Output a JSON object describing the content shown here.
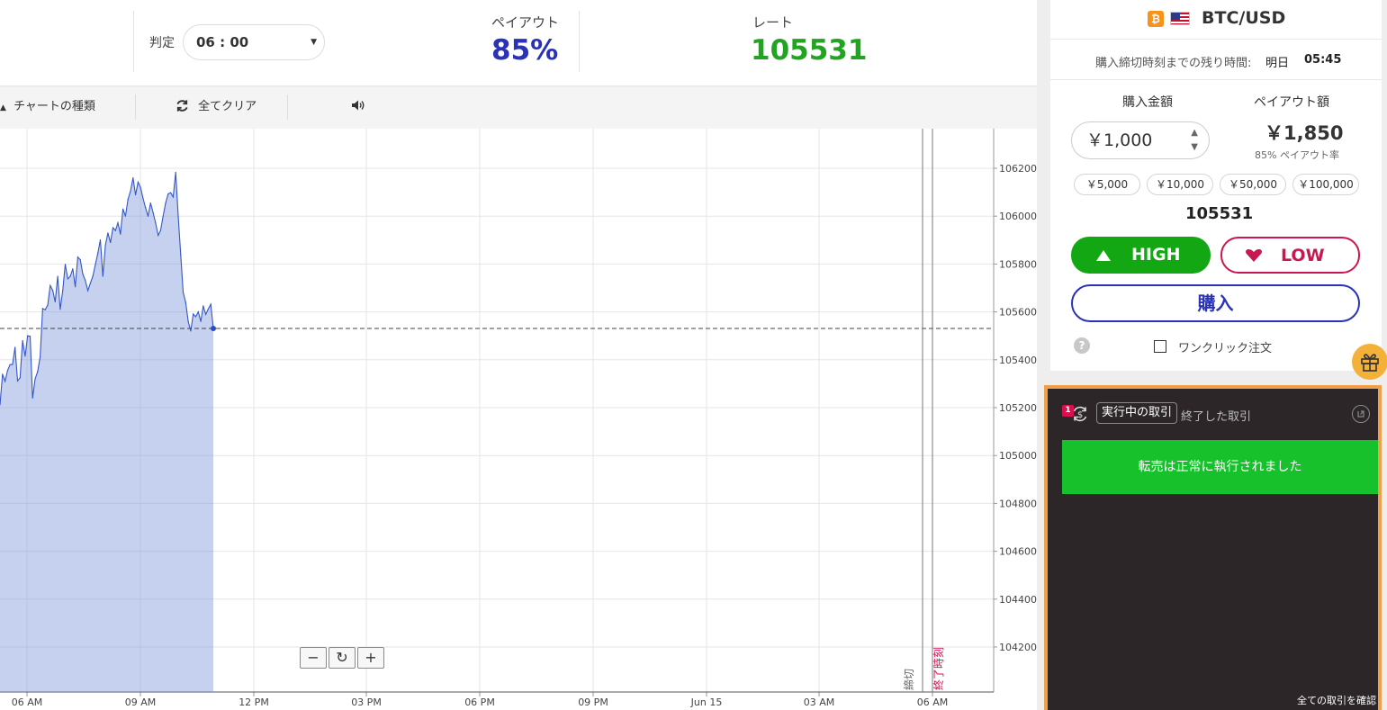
{
  "topbar": {
    "expiry_label": "判定",
    "expiry_value": "06 : 00",
    "payout_label": "ペイアウト",
    "payout_value": "85%",
    "rate_label": "レート",
    "rate_value": "105531"
  },
  "toolbar": {
    "chart_type_label": "チャートの種類",
    "clear_all_label": "全てクリア"
  },
  "chart_data": {
    "type": "area",
    "title": "",
    "xlabel": "",
    "ylabel": "",
    "x_tick_labels": [
      "06 AM",
      "09 AM",
      "12 PM",
      "03 PM",
      "06 PM",
      "09 PM",
      "Jun 15",
      "03 AM",
      "06 AM"
    ],
    "y_tick_labels": [
      "106200.",
      "106000.",
      "105800.",
      "105600.",
      "105400.",
      "105200.",
      "105000.",
      "104800.",
      "104600.",
      "104400.",
      "104200."
    ],
    "ylim": [
      104100,
      106350
    ],
    "current_rate": 105531,
    "closing_marker_label": "締切",
    "expiry_marker_label": "終了時刻",
    "series": [
      {
        "values": [
          105212,
          105340,
          105310,
          105355,
          105380,
          105380,
          105452,
          105312,
          105325,
          105480,
          105415,
          105500,
          105498,
          105240,
          105320,
          105350,
          105412,
          105614,
          105609,
          105628,
          105710,
          105690,
          105642,
          105749,
          105611,
          105689,
          105799,
          105738,
          105749,
          105780,
          105705,
          105829,
          105818,
          105759,
          105731,
          105689,
          105720,
          105750,
          105799,
          105845,
          105901,
          105749,
          105879,
          105930,
          105890,
          105952,
          105940,
          105972,
          105925,
          106030,
          106000,
          106070,
          106105,
          106160,
          106089,
          106142,
          106121,
          106075,
          106035,
          106000,
          106055,
          106015,
          105971,
          105920,
          105940,
          106000,
          106055,
          106093,
          106098,
          106080,
          106183,
          106000,
          105838,
          105682,
          105640,
          105560,
          105520,
          105591,
          105580,
          105600,
          105560,
          105625,
          105590,
          105612,
          105632,
          105531
        ],
        "color": "#3456c8"
      }
    ]
  },
  "panel": {
    "pair": "BTC/USD",
    "deadline_label": "購入締切時刻までの残り時間:",
    "deadline_day": "明日",
    "deadline_time": "05:45",
    "amount_label": "購入金額",
    "payout_amount_label": "ペイアウト額",
    "amount_value": "￥1,000",
    "payout_amount": "￥1,850",
    "payout_rate_text": "85% ペイアウト率",
    "presets": [
      "￥5,000",
      "￥10,000",
      "￥50,000",
      "￥100,000"
    ],
    "current_rate": "105531",
    "high_label": "HIGH",
    "low_label": "LOW",
    "buy_label": "購入",
    "oneclick_label": "ワンクリック注文"
  },
  "trades": {
    "badge": "1",
    "active_tab": "実行中の取引",
    "inactive_tab": "終了した取引",
    "toast": "転売は正常に執行されました",
    "view_all": "全ての取引を確認"
  },
  "colors": {
    "payout_blue": "#2a33b8",
    "rate_green": "#22a422",
    "high_green": "#13a813",
    "low_red": "#c8184f",
    "toast_green": "#16c12b",
    "panel_dark": "#2c2629",
    "highlight_orange": "#f0a04b"
  }
}
